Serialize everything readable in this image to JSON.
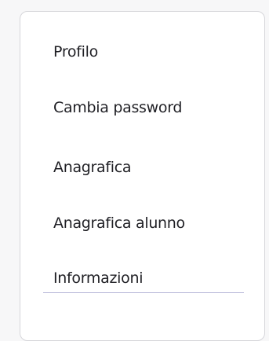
{
  "menu": {
    "items": [
      {
        "label": "Profilo"
      },
      {
        "label": "Cambia password"
      },
      {
        "label": "Anagrafica"
      },
      {
        "label": "Anagrafica alunno"
      },
      {
        "label": "Informazioni"
      }
    ]
  },
  "colors": {
    "card_background": "#ffffff",
    "card_border": "#d6d6da",
    "text": "#1f1f24",
    "divider": "#b9b9d9",
    "page_background": "#f7f7f8"
  }
}
